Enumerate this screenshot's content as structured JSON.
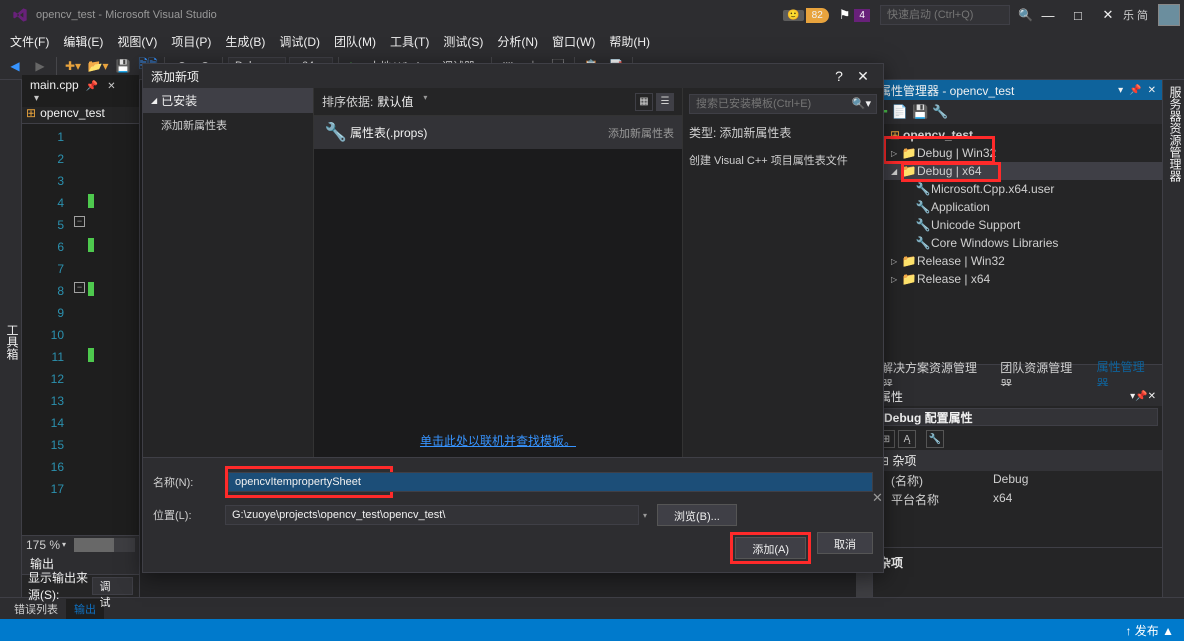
{
  "titlebar": {
    "title": "opencv_test - Microsoft Visual Studio",
    "badge_score": "82",
    "flag_count": "4",
    "quicklaunch_placeholder": "快速启动 (Ctrl+Q)",
    "lang_label": "乐 简"
  },
  "menubar": [
    "文件(F)",
    "编辑(E)",
    "视图(V)",
    "项目(P)",
    "生成(B)",
    "调试(D)",
    "团队(M)",
    "工具(T)",
    "测试(S)",
    "分析(N)",
    "窗口(W)",
    "帮助(H)"
  ],
  "toolbar": {
    "config_value": "Debug",
    "platform_value": "x64",
    "start_label": "本地 Windows 调试器"
  },
  "left_strip": "工具箱",
  "right_strip": "服务器资源管理器",
  "editor": {
    "tab_label": "main.cpp",
    "scope_label": "opencv_test",
    "line_numbers": [
      "1",
      "2",
      "3",
      "4",
      "5",
      "6",
      "7",
      "8",
      "9",
      "10",
      "11",
      "12",
      "13",
      "14",
      "15",
      "16",
      "17"
    ],
    "zoom": "175 %"
  },
  "output_panel": {
    "title": "输出",
    "source_label": "显示输出来源(S):",
    "source_value": "调试"
  },
  "bottom_tabs": {
    "err": "错误列表",
    "out": "输出"
  },
  "statusbar": {
    "publish": "发布 ▲"
  },
  "dialog": {
    "title": "添加新项",
    "left_header": "已安装",
    "left_item": "添加新属性表",
    "sort_label": "排序依据:",
    "sort_value": "默认值",
    "list_item_name": "属性表(.props)",
    "list_item_cat": "添加新属性表",
    "search_placeholder": "搜索已安装模板(Ctrl+E)",
    "desc_type_lbl": "类型:",
    "desc_type_val": "添加新属性表",
    "desc_line": "创建 Visual C++ 项目属性表文件",
    "online_link": "单击此处以联机并查找模板。",
    "name_label": "名称(N):",
    "name_value": "opencvItempropertySheet",
    "loc_label": "位置(L):",
    "loc_value": "G:\\zuoye\\projects\\opencv_test\\opencv_test\\",
    "browse_btn": "浏览(B)...",
    "add_btn": "添加(A)",
    "cancel_btn": "取消"
  },
  "propmgr": {
    "title": "属性管理器 - opencv_test",
    "root": "opencv_test",
    "items": [
      {
        "label": "Debug | Win32",
        "indent": 1,
        "tri": "▷",
        "ico": "📁"
      },
      {
        "label": "Debug | x64",
        "indent": 1,
        "tri": "◢",
        "selected": true,
        "ico": "📁"
      },
      {
        "label": "Microsoft.Cpp.x64.user",
        "indent": 2,
        "ico": "🔧"
      },
      {
        "label": "Application",
        "indent": 2,
        "ico": "🔧"
      },
      {
        "label": "Unicode Support",
        "indent": 2,
        "ico": "🔧"
      },
      {
        "label": "Core Windows Libraries",
        "indent": 2,
        "ico": "🔧"
      },
      {
        "label": "Release | Win32",
        "indent": 1,
        "tri": "▷",
        "ico": "📁"
      },
      {
        "label": "Release | x64",
        "indent": 1,
        "tri": "▷",
        "ico": "📁"
      }
    ],
    "tabs": {
      "sol": "解决方案资源管理器",
      "team": "团队资源管理器",
      "prop": "属性管理器"
    }
  },
  "proppane": {
    "title": "属性",
    "subject": "Debug 配置属性",
    "group": "杂项",
    "rows": [
      {
        "k": "(名称)",
        "v": "Debug"
      },
      {
        "k": "平台名称",
        "v": "x64"
      }
    ],
    "desc_title": "杂项"
  }
}
